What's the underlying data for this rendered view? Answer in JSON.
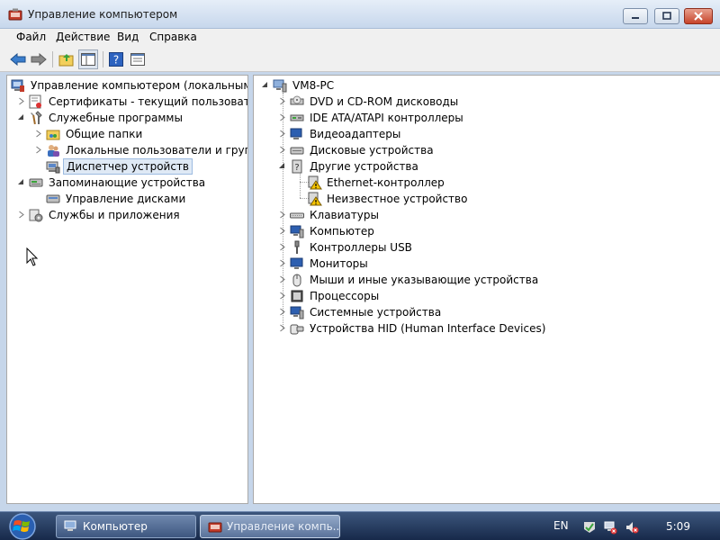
{
  "window": {
    "title": "Управление компьютером"
  },
  "menu": [
    "Файл",
    "Действие",
    "Вид",
    "Справка"
  ],
  "toolbar": {
    "icons": [
      "back-arrow-icon",
      "forward-arrow-icon",
      "up-folder-icon",
      "show-hide-tree-icon",
      "help-icon",
      "properties-icon"
    ]
  },
  "left_tree": {
    "root": "Управление компьютером (локальным)",
    "items": [
      "Сертификаты - текущий пользователь",
      "Служебные программы",
      "Общие папки",
      "Локальные пользователи и группы",
      "Диспетчер устройств",
      "Запоминающие устройства",
      "Управление дисками",
      "Службы и приложения"
    ]
  },
  "right_tree": {
    "root": "VM8-PC",
    "categories": [
      "DVD и CD-ROM дисководы",
      "IDE ATA/ATAPI контроллеры",
      "Видеоадаптеры",
      "Дисковые устройства",
      "Другие устройства",
      "Ethernet-контроллер",
      "Неизвестное устройство",
      "Клавиатуры",
      "Компьютер",
      "Контроллеры USB",
      "Мониторы",
      "Мыши и иные указывающие устройства",
      "Процессоры",
      "Системные устройства",
      "Устройства HID (Human Interface Devices)"
    ]
  },
  "taskbar": {
    "buttons": [
      "Компьютер",
      "Управление компь..."
    ],
    "language": "EN",
    "clock": "5:09"
  },
  "colors": {
    "selection": "#dfe9f5",
    "warning": "#f5c400",
    "taskbar": "#22385c"
  }
}
